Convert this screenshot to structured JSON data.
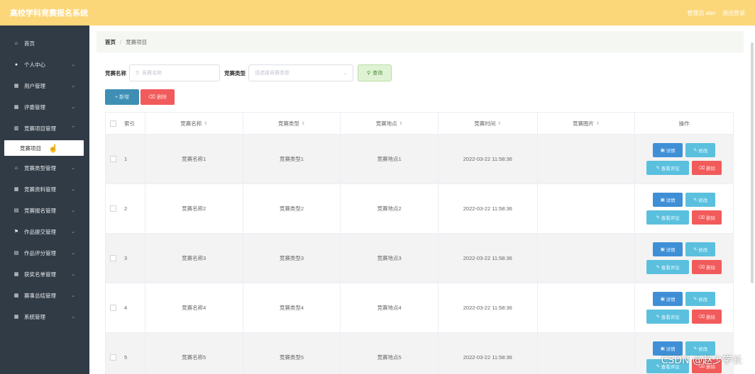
{
  "header": {
    "brand": "高校学科竞赛报名系统",
    "user": "管理员 abo",
    "logout": "退出登录"
  },
  "sidebar": {
    "items": [
      {
        "icon": "home-icon",
        "glyph": "⌂",
        "label": "首页",
        "chev": false
      },
      {
        "icon": "user-icon",
        "glyph": "●",
        "label": "个人中心",
        "chev": true
      },
      {
        "icon": "grid-icon",
        "glyph": "▦",
        "label": "用户管理",
        "chev": true
      },
      {
        "icon": "grid-icon",
        "glyph": "▦",
        "label": "评委管理",
        "chev": true
      },
      {
        "icon": "chart-icon",
        "glyph": "▥",
        "label": "竞赛项目管理",
        "chev": true
      }
    ],
    "sub_item": "竞赛项目",
    "items_after": [
      {
        "icon": "bank-icon",
        "glyph": "⌂",
        "label": "竞赛类型管理",
        "chev": true
      },
      {
        "icon": "grid-icon",
        "glyph": "▦",
        "label": "竞赛资料管理",
        "chev": true
      },
      {
        "icon": "doc-icon",
        "glyph": "▤",
        "label": "竞赛报名管理",
        "chev": true
      },
      {
        "icon": "flag-icon",
        "glyph": "⚑",
        "label": "作品提交管理",
        "chev": true
      },
      {
        "icon": "doc-icon",
        "glyph": "▤",
        "label": "作品评分管理",
        "chev": true
      },
      {
        "icon": "grid-icon",
        "glyph": "▦",
        "label": "获奖名单管理",
        "chev": true
      },
      {
        "icon": "grid-icon",
        "glyph": "▦",
        "label": "赛事总结管理",
        "chev": true
      },
      {
        "icon": "grid-icon",
        "glyph": "▦",
        "label": "系统管理",
        "chev": true
      }
    ]
  },
  "breadcrumb": {
    "home": "首页",
    "sep": "/",
    "current": "竞赛项目"
  },
  "search": {
    "name_label": "竞赛名称",
    "name_placeholder": "竞赛名称",
    "type_label": "竞赛类型",
    "type_placeholder": "请选择竞赛类型",
    "query_button": "查询"
  },
  "actions": {
    "add": "+ 新增",
    "delete": "删除"
  },
  "table": {
    "headers": {
      "index": "索引",
      "name": "竞赛名称",
      "type": "竞赛类型",
      "place": "竞赛地点",
      "time": "竞赛时间",
      "image": "竞赛图片",
      "ops": "操作"
    },
    "ops_labels": {
      "detail": "详情",
      "edit": "修改",
      "review": "查看评论",
      "delete": "删除"
    },
    "rows": [
      {
        "index": "1",
        "name": "竞赛名称1",
        "type": "竞赛类型1",
        "place": "竞赛地点1",
        "time": "2022-03-22 11:58:36"
      },
      {
        "index": "2",
        "name": "竞赛名称2",
        "type": "竞赛类型2",
        "place": "竞赛地点2",
        "time": "2022-03-22 11:58:36"
      },
      {
        "index": "3",
        "name": "竞赛名称3",
        "type": "竞赛类型3",
        "place": "竞赛地点3",
        "time": "2022-03-22 11:58:36"
      },
      {
        "index": "4",
        "name": "竞赛名称4",
        "type": "竞赛类型4",
        "place": "竞赛地点4",
        "time": "2022-03-22 11:58:36"
      },
      {
        "index": "5",
        "name": "竞赛名称5",
        "type": "竞赛类型5",
        "place": "竞赛地点5",
        "time": "2022-03-22 11:58:36"
      }
    ]
  },
  "watermark": "CSDN @赵少学长",
  "colors": {
    "topbar": "#fcd77a",
    "sidebar": "#303b46",
    "primary": "#3f8fd6",
    "info": "#5bc0de",
    "danger": "#f25b5b"
  }
}
